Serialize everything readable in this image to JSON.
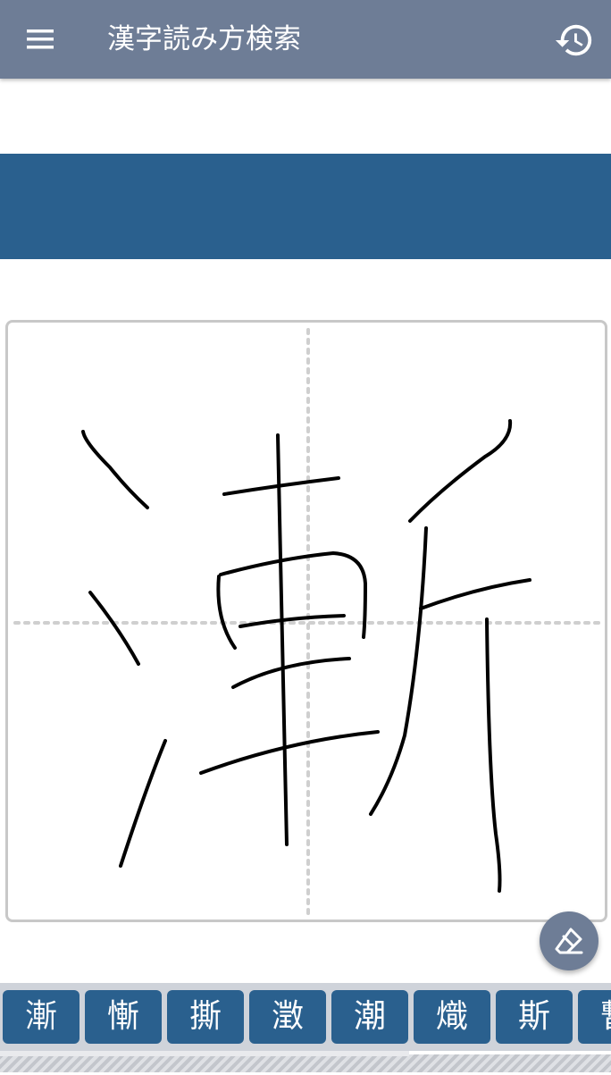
{
  "app": {
    "title": "漢字読み方検索"
  },
  "colors": {
    "appbar": "#6e7d96",
    "banner": "#2a608e",
    "candidate_bg": "#2a608e",
    "canvas_border": "#c8c8c8"
  },
  "icons": {
    "menu": "menu-icon",
    "history": "history-icon",
    "eraser": "eraser-icon"
  },
  "candidates": [
    "漸",
    "慚",
    "撕",
    "澂",
    "潮",
    "熾",
    "斯",
    "暫"
  ],
  "candidate_scroll_progress": 0.67
}
